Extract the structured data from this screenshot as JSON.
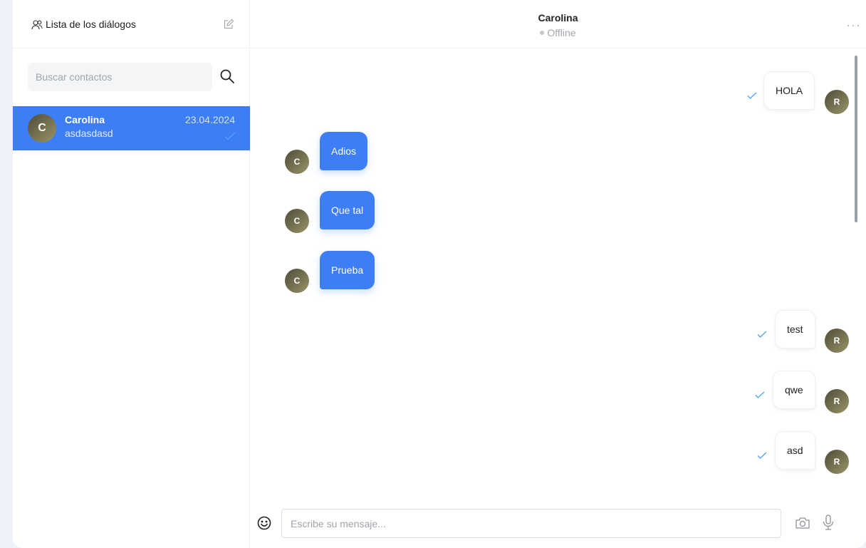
{
  "sidebar": {
    "title": "Lista de los diálogos",
    "search": {
      "placeholder": "Buscar contactos",
      "value": ""
    },
    "dialogs": [
      {
        "name": "Carolina",
        "initial": "C",
        "preview": "asdasdasd",
        "date": "23.04.2024",
        "selected": true
      }
    ]
  },
  "chat": {
    "contact_name": "Carolina",
    "status": "Offline",
    "messages": [
      {
        "direction": "out",
        "text": "HOLA",
        "avatar": "R",
        "read": true
      },
      {
        "direction": "in",
        "text": "Adios",
        "avatar": "C"
      },
      {
        "direction": "in",
        "text": "Que tal",
        "avatar": "C"
      },
      {
        "direction": "in",
        "text": "Prueba",
        "avatar": "C"
      },
      {
        "direction": "out",
        "text": "test",
        "avatar": "R",
        "read": true
      },
      {
        "direction": "out",
        "text": "qwe",
        "avatar": "R",
        "read": true
      },
      {
        "direction": "out",
        "text": "asd",
        "avatar": "R",
        "read": true
      }
    ],
    "input": {
      "placeholder": "Escribe su mensaje...",
      "value": ""
    }
  },
  "colors": {
    "accent": "#3d7ef5",
    "page_background": "#eef1f8",
    "tick": "#4aa3ff"
  },
  "icons": [
    "users-icon",
    "edit-icon",
    "search-icon",
    "check-icon",
    "more-icon",
    "emoji-icon",
    "camera-icon",
    "microphone-icon"
  ]
}
